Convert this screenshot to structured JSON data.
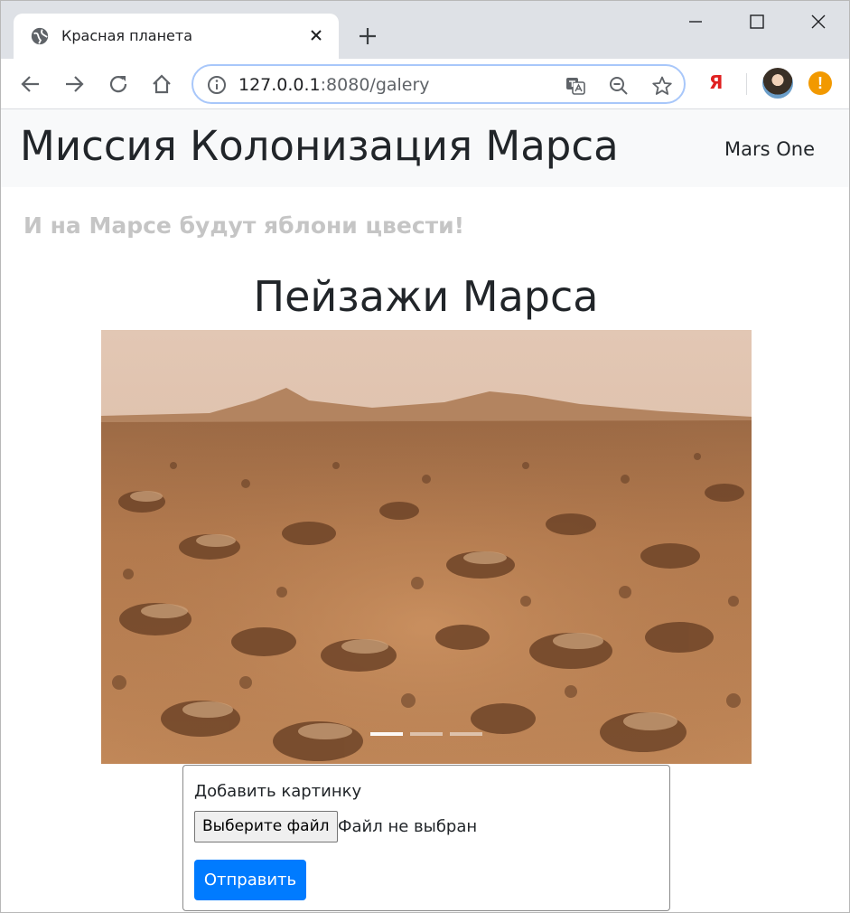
{
  "browser": {
    "tab_title": "Красная планета",
    "url_host": "127.0.0.1",
    "url_rest": ":8080/galery",
    "yandex_label": "Я",
    "alert_label": "!"
  },
  "colors": {
    "primary_button": "#007bff",
    "navbar_bg": "#f8f9fa",
    "motto_text": "#c5c5c5"
  },
  "navbar": {
    "brand": "Миссия Колонизация Марса",
    "link": "Mars One"
  },
  "main": {
    "motto": "И на Марсе будут яблони цвести!",
    "gallery_title": "Пейзажи Марса",
    "carousel": {
      "slide_count": 3,
      "active_index": 0,
      "image_alt": "Марсианский пейзаж"
    },
    "form": {
      "label": "Добавить картинку",
      "file_button": "Выберите файл",
      "file_status": "Файл не выбран",
      "submit": "Отправить"
    }
  }
}
